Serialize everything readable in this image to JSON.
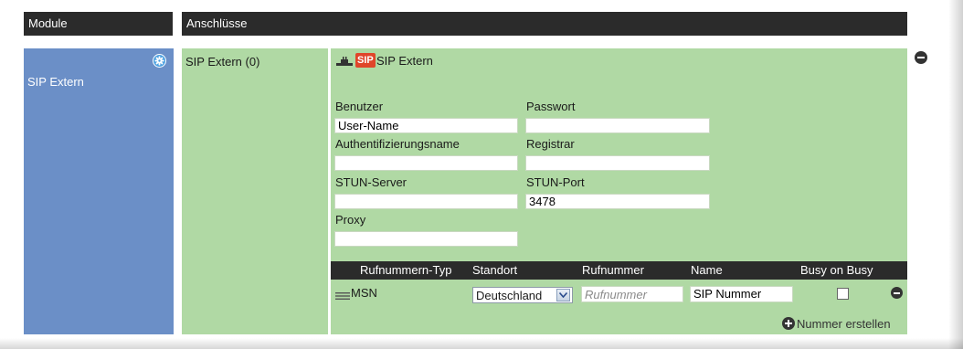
{
  "header": {
    "modules_label": "Module",
    "connections_label": "Anschlüsse"
  },
  "module": {
    "name": "SIP Extern"
  },
  "connection": {
    "name": "SIP Extern (0)"
  },
  "panel": {
    "badge": "SIP",
    "title": "SIP Extern",
    "fields": {
      "user_label": "Benutzer",
      "user_value": "User-Name",
      "password_label": "Passwort",
      "password_value": "",
      "auth_label": "Authentifizierungsname",
      "auth_value": "",
      "registrar_label": "Registrar",
      "registrar_value": "",
      "stun_server_label": "STUN-Server",
      "stun_server_value": "",
      "stun_port_label": "STUN-Port",
      "stun_port_value": "3478",
      "proxy_label": "Proxy",
      "proxy_value": ""
    },
    "table": {
      "columns": [
        "Rufnummern-Typ",
        "Standort",
        "Rufnummer",
        "Name",
        "Busy on Busy"
      ],
      "row": {
        "type": "MSN",
        "location": "Deutschland",
        "number_value": "",
        "number_placeholder": "Rufnummer",
        "name_value": "SIP Nummer",
        "busy_on_busy": false
      }
    },
    "create_number_label": "Nummer erstellen"
  },
  "icons": [
    "gear-icon",
    "plug-icon",
    "remove-icon",
    "drag-handle-icon",
    "add-icon",
    "chevron-down-icon"
  ],
  "colors": {
    "header_bg": "#2b2b2b",
    "module_bg": "#6b8fc7",
    "connection_bg": "#b0d9a4",
    "badge_bg": "#e0452a"
  }
}
